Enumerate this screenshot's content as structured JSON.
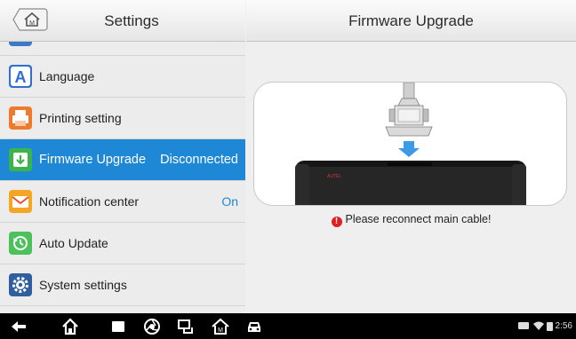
{
  "left_panel": {
    "title": "Settings",
    "items": [
      {
        "label": "",
        "value": "",
        "icon": "generic-icon"
      },
      {
        "label": "Language",
        "value": "",
        "icon": "language-icon"
      },
      {
        "label": "Printing setting",
        "value": "",
        "icon": "printer-icon"
      },
      {
        "label": "Firmware Upgrade",
        "value": "Disconnected",
        "icon": "firmware-upgrade-icon",
        "active": true
      },
      {
        "label": "Notification center",
        "value": "On",
        "icon": "notification-icon"
      },
      {
        "label": "Auto Update",
        "value": "",
        "icon": "auto-update-icon"
      },
      {
        "label": "System settings",
        "value": "",
        "icon": "gear-icon"
      },
      {
        "label": "",
        "value": "",
        "icon": "generic-icon"
      }
    ]
  },
  "right_panel": {
    "title": "Firmware Upgrade",
    "device_brand": "AUTEL",
    "message": "Please reconnect main cable!"
  },
  "status_bar": {
    "time": "2:56"
  },
  "colors": {
    "active_item": "#1e88d6",
    "error": "#e02020"
  }
}
